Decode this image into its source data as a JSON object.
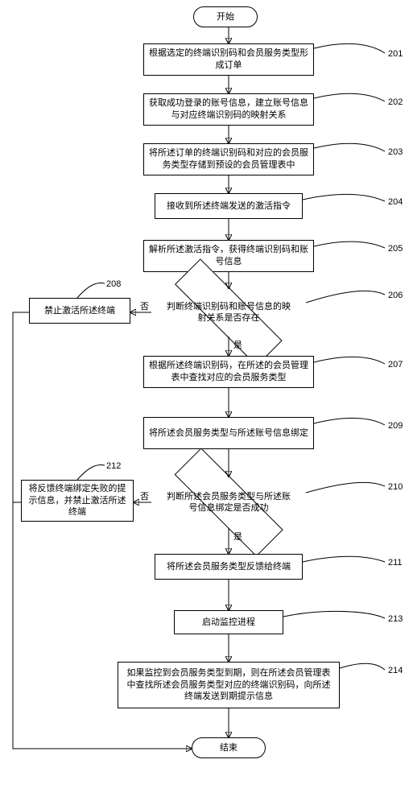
{
  "flow": {
    "start": "开始",
    "end": "结束",
    "steps": {
      "s201": "根据选定的终端识别码和会员服务类型形成订单",
      "s202": "获取成功登录的账号信息，建立账号信息与对应终端识别码的映射关系",
      "s203": "将所述订单的终端识别码和对应的会员服务类型存储到预设的会员管理表中",
      "s204": "接收到所述终端发送的激活指令",
      "s205": "解析所述激活指令，获得终端识别码和账号信息",
      "d206": "判断终端识别码和账号信息的映射关系是否存在",
      "s207": "根据所述终端识别码，在所述的会员管理表中查找对应的会员服务类型",
      "s208": "禁止激活所述终端",
      "s209": "将所述会员服务类型与所述账号信息绑定",
      "d210": "判断所述会员服务类型与所述账号信息绑定是否成功",
      "s211": "将所述会员服务类型反馈给终端",
      "s212": "将反馈终端绑定失败的提示信息，并禁止激活所述终端",
      "s213": "启动监控进程",
      "s214": "如果监控到会员服务类型到期，则在所述会员管理表中查找所述会员服务类型对应的终端识别码，向所述终端发送到期提示信息"
    },
    "labels": {
      "n201": "201",
      "n202": "202",
      "n203": "203",
      "n204": "204",
      "n205": "205",
      "n206": "206",
      "n207": "207",
      "n208": "208",
      "n209": "209",
      "n210": "210",
      "n211": "211",
      "n212": "212",
      "n213": "213",
      "n214": "214",
      "yes": "是",
      "no": "否"
    }
  }
}
